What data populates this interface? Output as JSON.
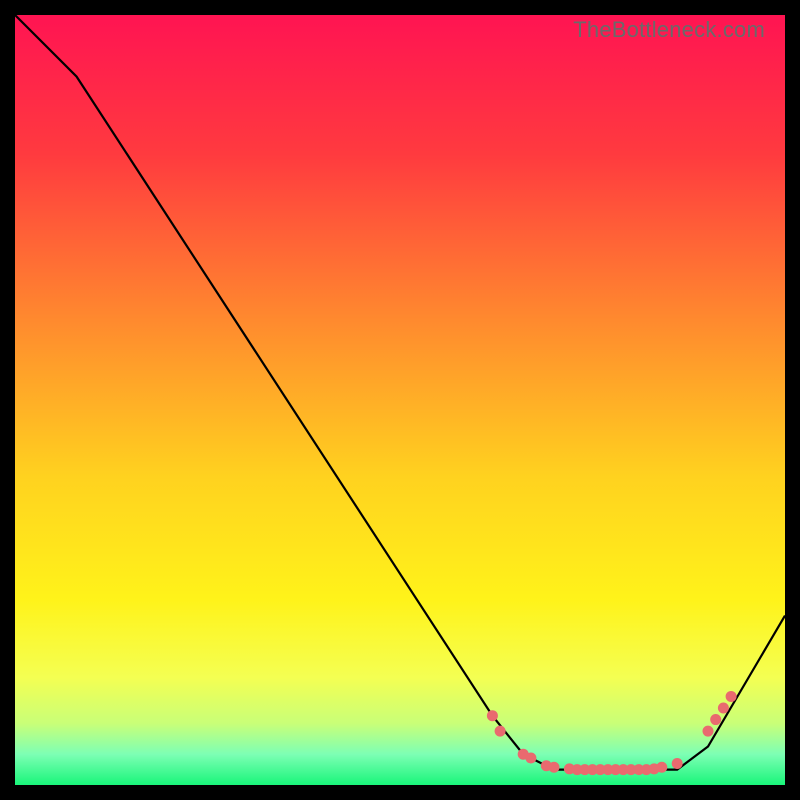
{
  "watermark": "TheBottleneck.com",
  "chart_data": {
    "type": "line",
    "title": "",
    "xlabel": "",
    "ylabel": "",
    "xlim": [
      0,
      100
    ],
    "ylim": [
      0,
      100
    ],
    "gradient_stops": [
      {
        "offset": 0,
        "color": "#ff1452"
      },
      {
        "offset": 18,
        "color": "#ff3a3f"
      },
      {
        "offset": 40,
        "color": "#ff8b2e"
      },
      {
        "offset": 60,
        "color": "#ffd21f"
      },
      {
        "offset": 76,
        "color": "#fff31a"
      },
      {
        "offset": 86,
        "color": "#f4ff52"
      },
      {
        "offset": 92,
        "color": "#c9ff78"
      },
      {
        "offset": 96,
        "color": "#7dffb4"
      },
      {
        "offset": 100,
        "color": "#19f57a"
      }
    ],
    "curve": [
      {
        "x": 0,
        "y": 100
      },
      {
        "x": 8,
        "y": 92
      },
      {
        "x": 62,
        "y": 9
      },
      {
        "x": 66,
        "y": 4
      },
      {
        "x": 70,
        "y": 2
      },
      {
        "x": 86,
        "y": 2
      },
      {
        "x": 90,
        "y": 5
      },
      {
        "x": 100,
        "y": 22
      }
    ],
    "markers": [
      {
        "x": 62,
        "y": 9
      },
      {
        "x": 63,
        "y": 7
      },
      {
        "x": 66,
        "y": 4
      },
      {
        "x": 67,
        "y": 3.5
      },
      {
        "x": 69,
        "y": 2.5
      },
      {
        "x": 70,
        "y": 2.3
      },
      {
        "x": 72,
        "y": 2.1
      },
      {
        "x": 73,
        "y": 2
      },
      {
        "x": 74,
        "y": 2
      },
      {
        "x": 75,
        "y": 2
      },
      {
        "x": 76,
        "y": 2
      },
      {
        "x": 77,
        "y": 2
      },
      {
        "x": 78,
        "y": 2
      },
      {
        "x": 79,
        "y": 2
      },
      {
        "x": 80,
        "y": 2
      },
      {
        "x": 81,
        "y": 2
      },
      {
        "x": 82,
        "y": 2
      },
      {
        "x": 83,
        "y": 2.1
      },
      {
        "x": 84,
        "y": 2.3
      },
      {
        "x": 86,
        "y": 2.8
      },
      {
        "x": 90,
        "y": 7
      },
      {
        "x": 91,
        "y": 8.5
      },
      {
        "x": 92,
        "y": 10
      },
      {
        "x": 93,
        "y": 11.5
      }
    ],
    "marker_color": "#e96a6f",
    "curve_color": "#000000"
  }
}
